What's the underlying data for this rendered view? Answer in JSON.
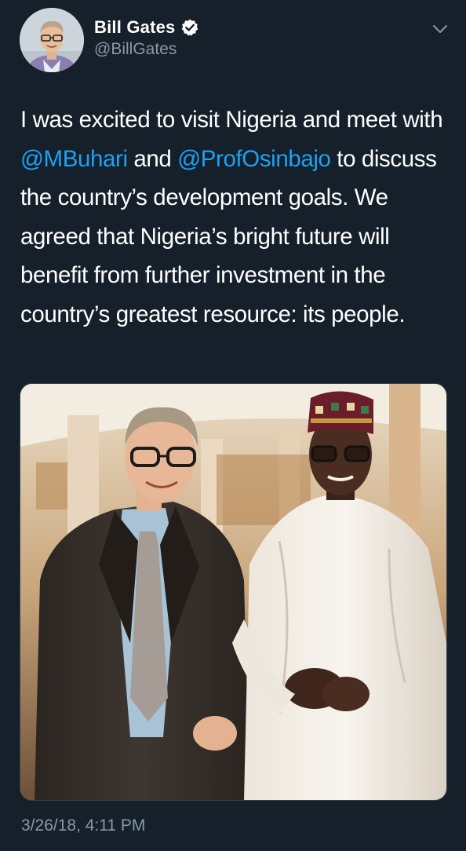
{
  "user": {
    "display_name": "Bill Gates",
    "handle": "@BillGates",
    "verified": true,
    "avatar_icon": "profile-photo"
  },
  "tweet": {
    "text_segments": [
      {
        "text": "I was excited to visit Nigeria and meet with ",
        "type": "plain"
      },
      {
        "text": "@MBuhari",
        "type": "mention"
      },
      {
        "text": " and ",
        "type": "plain"
      },
      {
        "text": "@ProfOsinbajo",
        "type": "mention"
      },
      {
        "text": " to discuss the country’s development goals. We agreed that Nigeria’s bright future will benefit from further investment in the country’s greatest resource: its people.",
        "type": "plain"
      }
    ],
    "timestamp": "3/26/18, 4:11 PM"
  },
  "colors": {
    "background": "#15202b",
    "link": "#1da1f2",
    "secondary_text": "#8899a6",
    "verified_badge": "#ffffff"
  },
  "icons": {
    "menu": "chevron-down-icon",
    "verified": "verified-badge-icon"
  }
}
